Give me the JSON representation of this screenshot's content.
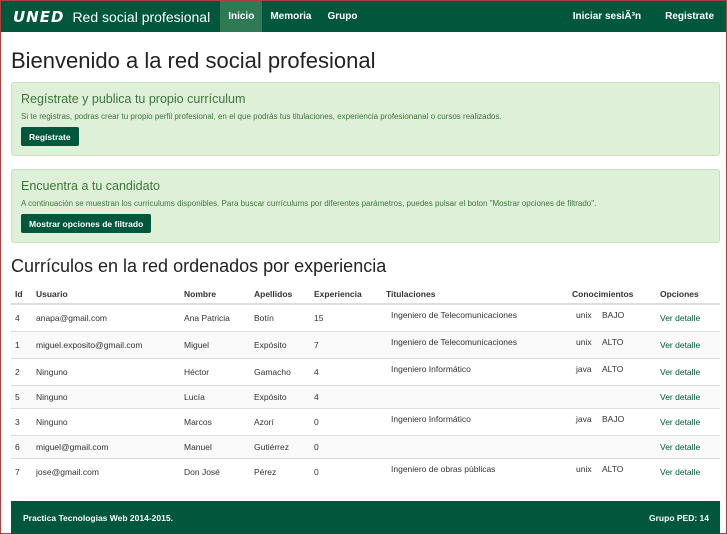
{
  "navbar": {
    "logo": "UNED",
    "brand": "Red social profesional",
    "links": [
      {
        "label": "Inicio",
        "active": true
      },
      {
        "label": "Memoria",
        "active": false
      },
      {
        "label": "Grupo",
        "active": false
      }
    ],
    "right_links": [
      {
        "label": "Iniciar sesiÃ³n"
      },
      {
        "label": "Registrate"
      }
    ],
    "color": "#00573c"
  },
  "page_title": "Bienvenido a la red social profesional",
  "panels": [
    {
      "title": "Regístrate y publica tu propio currículum",
      "text": "Si te registras, podras crear tu propio perfil profesional, en el que podrás tus titulaciones, experiencia profesionanal o cursos realizados.",
      "button": "Regístrate"
    },
    {
      "title": "Encuentra a tu candidato",
      "text": "A continuación se muestran los curriculums disponibles. Para buscar currículums por diferentes parámetros, puedes pulsar el boton \"Mostrar opciones de filtrado\".",
      "button": "Mostrar opciones de filtrado"
    }
  ],
  "section_title": "Currículos en la red ordenados por experiencia",
  "table": {
    "headers": [
      "Id",
      "Usuario",
      "Nombre",
      "Apellidos",
      "Experiencia",
      "Titulaciones",
      "Conocimientos",
      "Opciones"
    ],
    "rows": [
      {
        "id": "4",
        "usuario": "anapa@gmail.com",
        "nombre": "Ana Patricia",
        "apellidos": "Botín",
        "experiencia": "15",
        "titulacion": "Ingeniero de Telecomunicaciones",
        "tech": "unix",
        "nivel": "BAJO",
        "opcion": "Ver detalle"
      },
      {
        "id": "1",
        "usuario": "miguel.exposito@gmail.com",
        "nombre": "Miguel",
        "apellidos": "Expósito",
        "experiencia": "7",
        "titulacion": "Ingeniero de Telecomunicaciones",
        "tech": "unix",
        "nivel": "ALTO",
        "opcion": "Ver detalle"
      },
      {
        "id": "2",
        "usuario": "Ninguno",
        "nombre": "Héctor",
        "apellidos": "Gamacho",
        "experiencia": "4",
        "titulacion": "Ingeniero Informático",
        "tech": "java",
        "nivel": "ALTO",
        "opcion": "Ver detalle"
      },
      {
        "id": "5",
        "usuario": "Ninguno",
        "nombre": "Lucía",
        "apellidos": "Expósito",
        "experiencia": "4",
        "titulacion": "",
        "tech": "",
        "nivel": "",
        "opcion": "Ver detalle"
      },
      {
        "id": "3",
        "usuario": "Ninguno",
        "nombre": "Marcos",
        "apellidos": "Azorí",
        "experiencia": "0",
        "titulacion": "Ingeniero Informático",
        "tech": "java",
        "nivel": "BAJO",
        "opcion": "Ver detalle"
      },
      {
        "id": "6",
        "usuario": "miguel@gmail.com",
        "nombre": "Manuel",
        "apellidos": "Gutiérrez",
        "experiencia": "0",
        "titulacion": "",
        "tech": "",
        "nivel": "",
        "opcion": "Ver detalle"
      },
      {
        "id": "7",
        "usuario": "jose@gmail.com",
        "nombre": "Don José",
        "apellidos": "Pérez",
        "experiencia": "0",
        "titulacion": "Ingeniero de obras públicas",
        "tech": "unix",
        "nivel": "ALTO",
        "opcion": "Ver detalle"
      }
    ]
  },
  "footer": {
    "left": "Practica Tecnologias Web 2014-2015.",
    "right": "Grupo PED: 14"
  }
}
